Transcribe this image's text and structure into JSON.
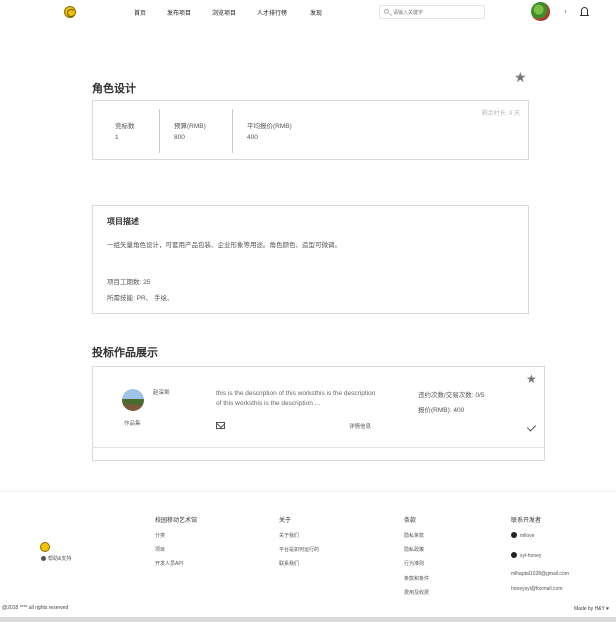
{
  "nav": {
    "links": [
      "首页",
      "发布项目",
      "浏览项目",
      "人才排行榜",
      "发现"
    ],
    "search_placeholder": "请输入关键字",
    "separator": "|"
  },
  "project": {
    "title": "角色设计",
    "remaining": "剩余时长: 9 天",
    "stats": [
      {
        "label": "竞标数",
        "value": "1"
      },
      {
        "label": "预算(RMB)",
        "value": "800"
      },
      {
        "label": "平均报价(RMB)",
        "value": "400"
      }
    ]
  },
  "description": {
    "title": "项目描述",
    "text": "一组矢量角色设计，可套用产品包装、企业形象等用途。角色颜色、造型可微调。",
    "period": "项目工期数:  25",
    "skills": "所需技能:  PR、 手绘、"
  },
  "works": {
    "title": "投标作品展示",
    "items": [
      {
        "author": "赵深圳",
        "gallery_label": "作品集",
        "description": "this is the description of this worksthis is the description of this worksthis is the description ...",
        "detail_label": "详情信息",
        "violations": "违约次数/交易次数: 0/5",
        "quote": "报价(RMB):  400"
      }
    ]
  },
  "footer": {
    "support": "帮助&支持",
    "columns": [
      {
        "title": "校园移动艺术馆",
        "items": [
          "分类",
          "项目",
          "开发人员API"
        ]
      },
      {
        "title": "关于",
        "items": [
          "关于我们",
          "平台是如何运行的",
          "联系我们"
        ]
      },
      {
        "title": "条款",
        "items": [
          "隐私条款",
          "隐私政策",
          "行为准则",
          "条款和条件",
          "费用及收费"
        ]
      }
    ],
    "contact": {
      "title": "联系开发者",
      "github": [
        "mllove",
        "syl-honey"
      ],
      "emails": [
        "mlhaptal1028@gmail.com",
        "honeysyl@foxmail.com"
      ]
    },
    "copyright": "@2018 **** all rights reserved",
    "made_by": "Made by H&Y ♥"
  },
  "colors": {
    "border": "#d9d9d9",
    "star": "#777777",
    "logo": "#f2c200"
  }
}
